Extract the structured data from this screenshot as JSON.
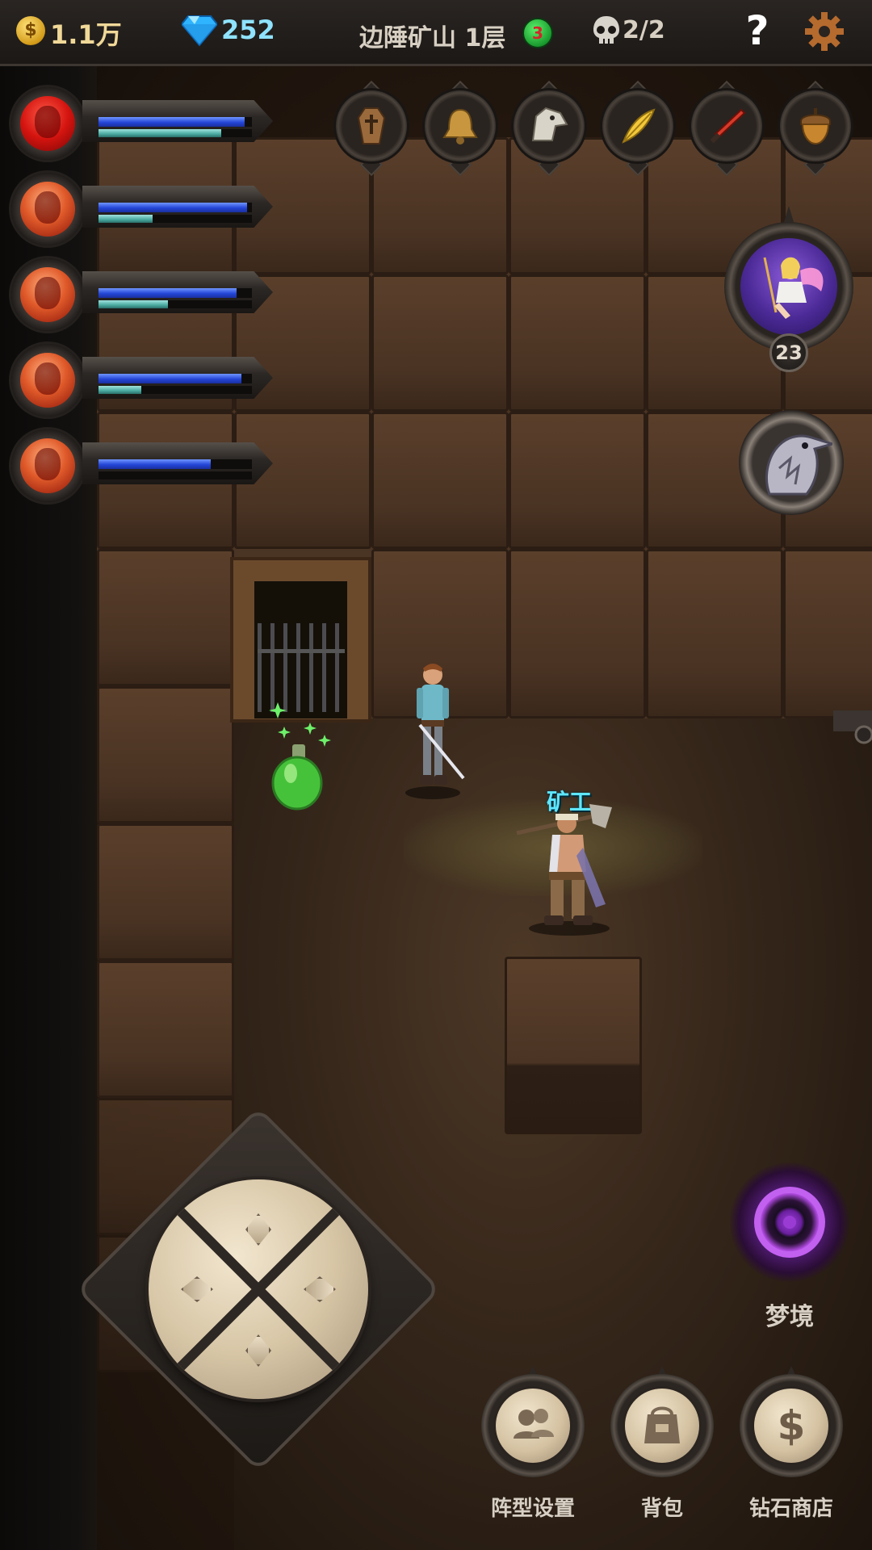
{
  "topbar": {
    "gold": "1.1万",
    "gold_icon": "$",
    "gems": "252",
    "level_title": "边陲矿山 1层",
    "badge_count": "3",
    "kills": "2/2",
    "help_label": "?"
  },
  "party": [
    {
      "hp": 0.95,
      "mp": 0.8
    },
    {
      "hp": 0.97,
      "mp": 0.35
    },
    {
      "hp": 0.9,
      "mp": 0.45
    },
    {
      "hp": 0.93,
      "mp": 0.28
    },
    {
      "hp": 0.73,
      "mp": 0.0
    }
  ],
  "relics": [
    "coffin-relic-icon",
    "bell-relic-icon",
    "dragon-head-relic-icon",
    "golden-feather-relic-icon",
    "red-dagger-relic-icon",
    "acorn-relic-icon"
  ],
  "fairy": {
    "count": "23"
  },
  "characters": {
    "miner_name": "矿工"
  },
  "dream": {
    "label": "梦境"
  },
  "actions": [
    {
      "label": "阵型设置",
      "icon": "team-icon"
    },
    {
      "label": "背包",
      "icon": "backpack-icon"
    },
    {
      "label": "钻石商店",
      "icon": "dollar-icon",
      "glyph": "$"
    }
  ],
  "colors": {
    "hp": "#2446d8",
    "mp": "#49a9a0",
    "accent_cyan": "#5fe6ff",
    "gold": "#f0d898"
  }
}
